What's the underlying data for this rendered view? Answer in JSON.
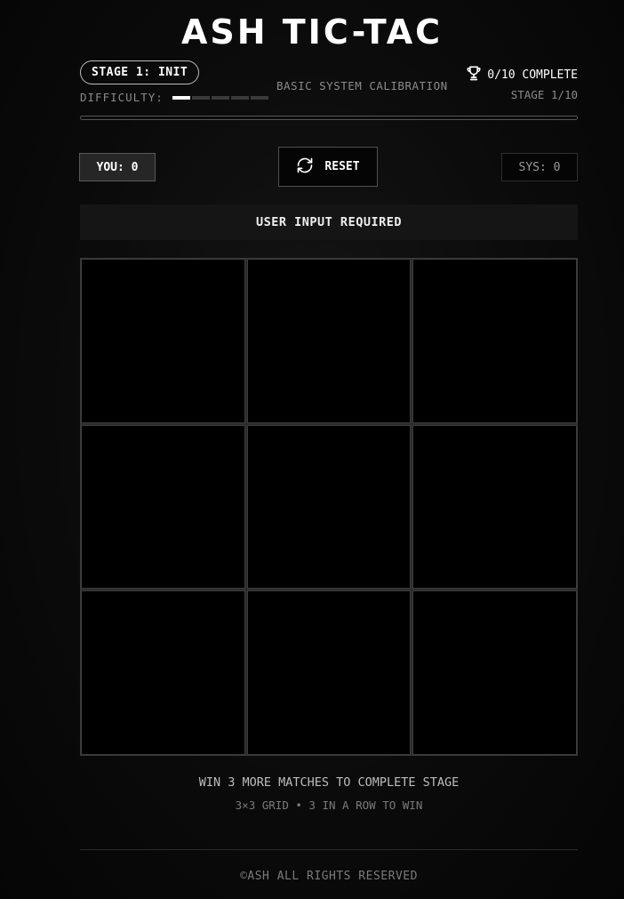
{
  "header": {
    "title": "ASH TIC-TAC",
    "stage_label": "STAGE 1: INIT",
    "difficulty_label": "DIFFICULTY:",
    "difficulty_level": 1,
    "difficulty_max": 5,
    "stage_description": "BASIC SYSTEM CALIBRATION",
    "complete_text": "0/10 COMPLETE",
    "stage_count": "STAGE 1/10",
    "progress_fraction": 0,
    "trophy_icon": "trophy-icon"
  },
  "scoreboard": {
    "you_label": "YOU: 0",
    "reset_label": "RESET",
    "reset_icon": "refresh-icon",
    "sys_label": "SYS: 0"
  },
  "status": {
    "message": "USER INPUT REQUIRED"
  },
  "board": {
    "size": 3,
    "cells": [
      "",
      "",
      "",
      "",
      "",
      "",
      "",
      "",
      ""
    ]
  },
  "info": {
    "hint": "WIN 3 MORE MATCHES TO COMPLETE STAGE",
    "rules": "3×3 GRID • 3 IN A ROW TO WIN"
  },
  "footer": {
    "copyright": "©ASH ALL RIGHTS RESERVED"
  }
}
